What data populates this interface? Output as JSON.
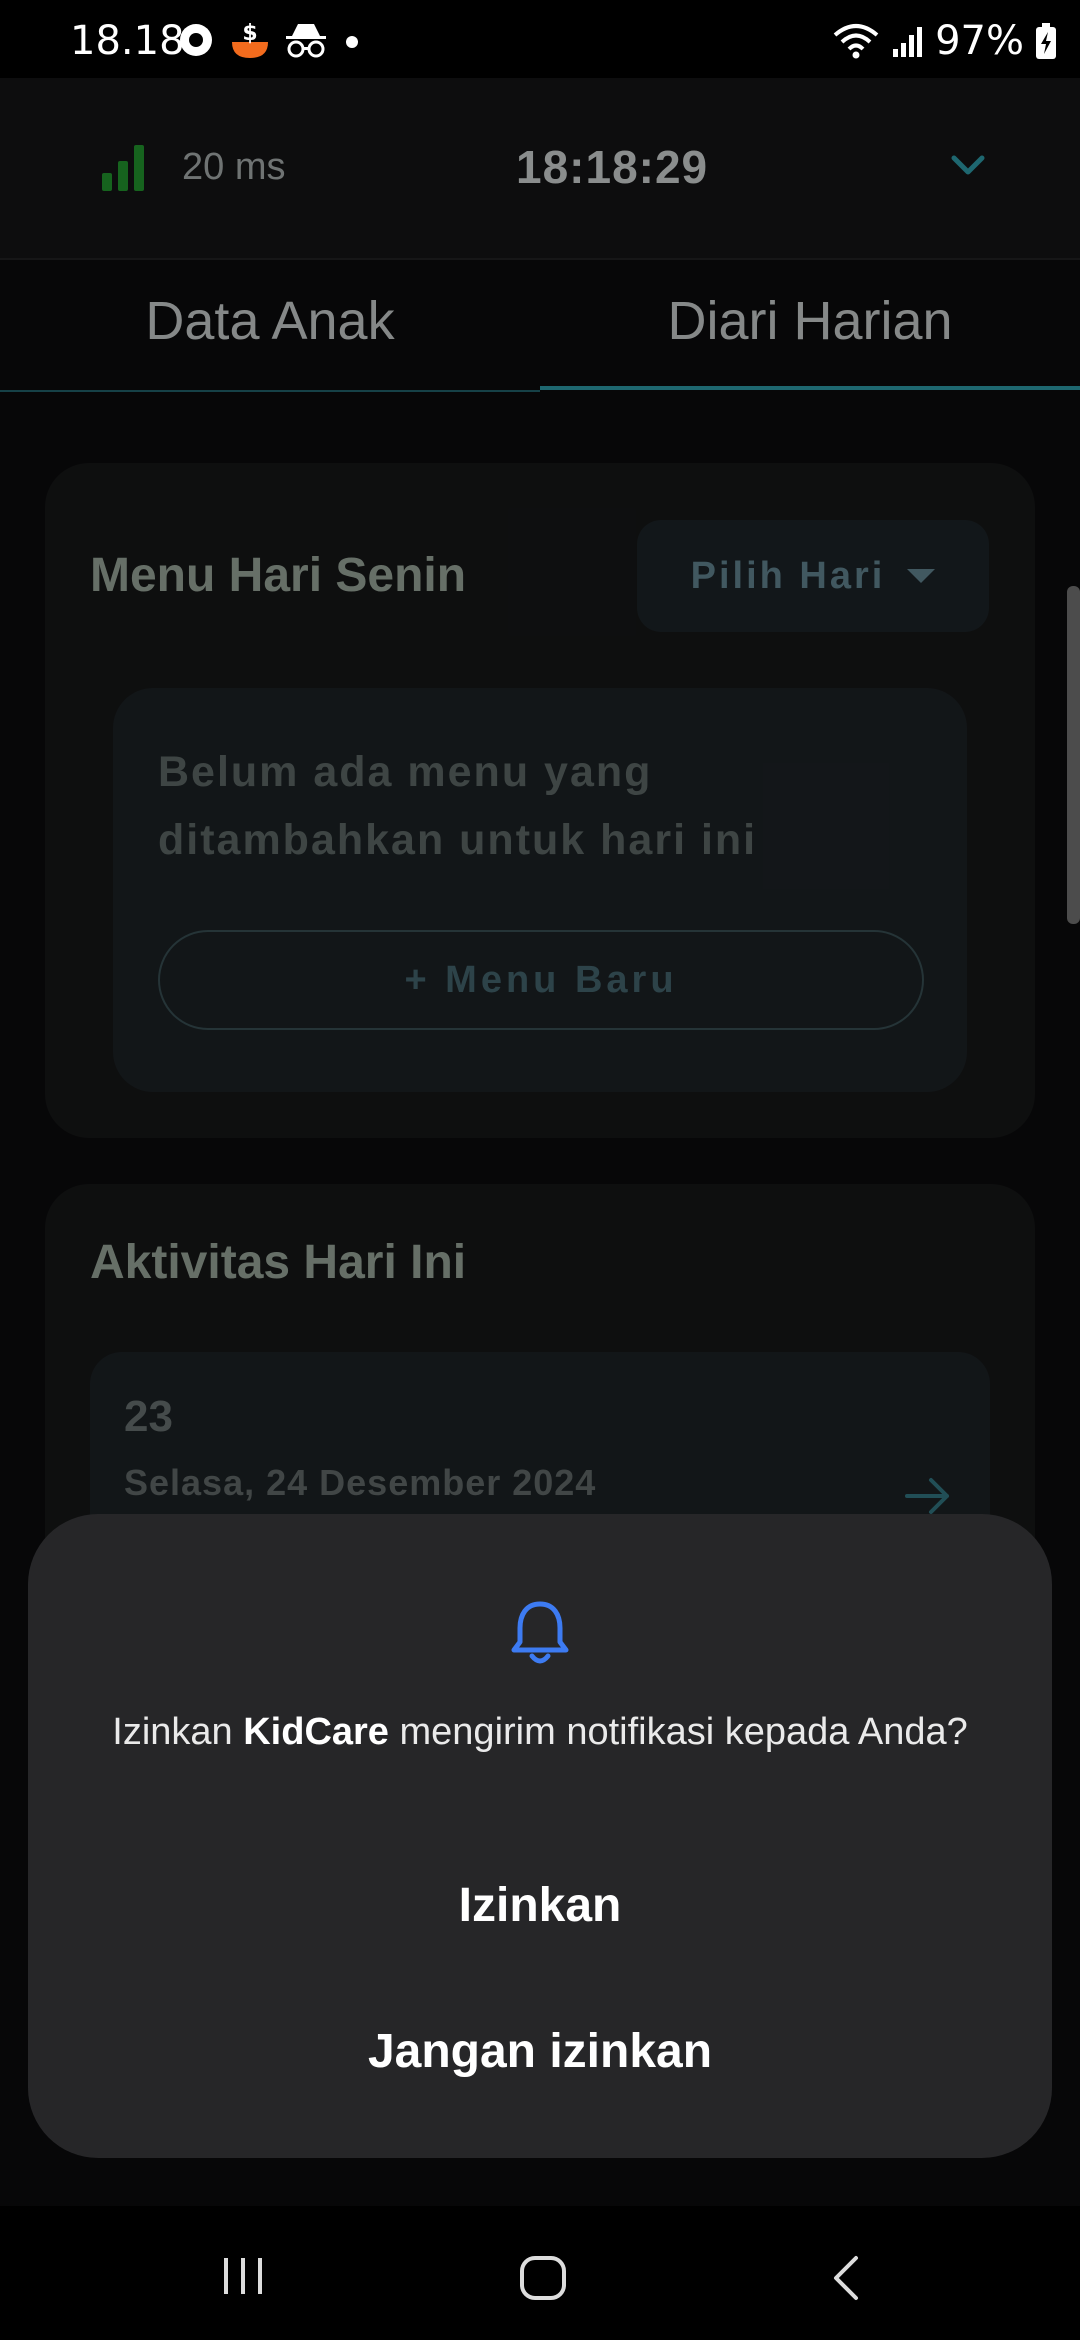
{
  "status_bar": {
    "time": "18.18",
    "battery": "97%"
  },
  "header": {
    "ping": "20 ms",
    "clock": "18:18:29",
    "menu_icon": "chevron-down-icon"
  },
  "tabs": [
    {
      "label": "Data Anak",
      "active": false
    },
    {
      "label": "Diari Harian",
      "active": true
    }
  ],
  "menu_card": {
    "title": "Menu Hari Senin",
    "day_picker_label": "Pilih Hari",
    "empty_text": "Belum ada menu yang ditambahkan untuk hari ini",
    "new_menu_label": "+ Menu Baru"
  },
  "activity_card": {
    "title": "Aktivitas Hari Ini",
    "items": [
      {
        "number": "23",
        "date": "Selasa, 24 Desember 2024"
      }
    ]
  },
  "dialog": {
    "icon": "bell-icon",
    "message_prefix": "Izinkan ",
    "app_name": "KidCare",
    "message_suffix": " mengirim notifikasi kepada Anda?",
    "allow_label": "Izinkan",
    "deny_label": "Jangan izinkan"
  },
  "colors": {
    "accent": "#2a8f9c",
    "ping_green": "#1f8a2a",
    "bell_blue": "#3d7bf2"
  }
}
